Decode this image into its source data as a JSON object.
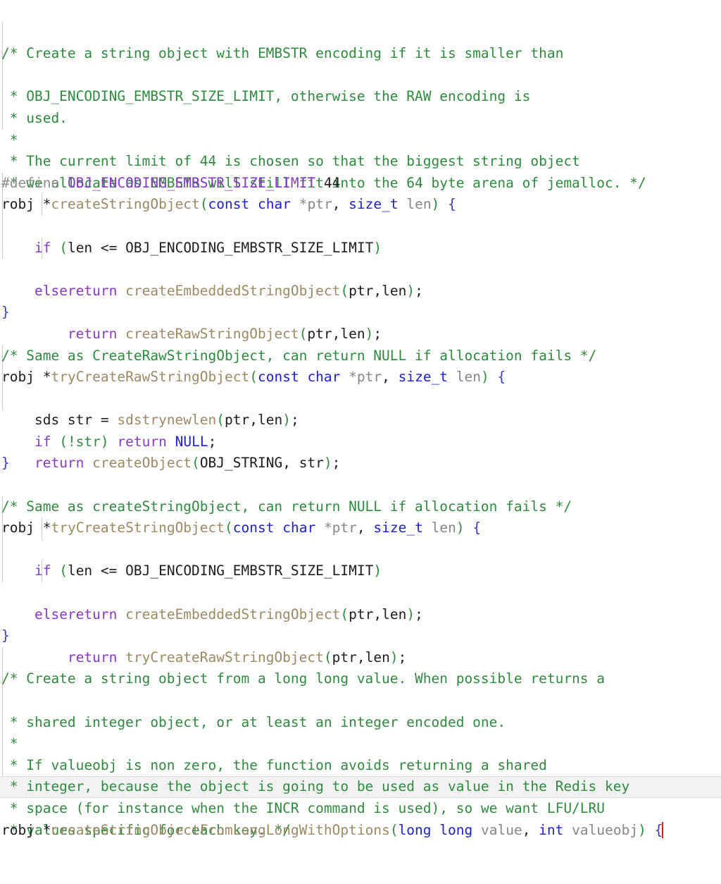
{
  "editor": {
    "language": "c",
    "background": "#ffffff",
    "current_line_highlight": "#f2f2f2",
    "caret_color": "#cc2222",
    "colors": {
      "comment": "#2e8b3d",
      "keyword": "#8a39c4",
      "type": "#2020d0",
      "constant": "#2020d0",
      "function": "#9c8a62",
      "identifier": "#1d1d1d",
      "parameter": "#878787",
      "preprocessor": "#8e8e8e",
      "macro": "#8a39c4",
      "punctuation": "#2e8b3d",
      "brace": "#3b3bbf",
      "indent_guide": "#c8c8c8"
    }
  },
  "code": {
    "l1": "/* Create a string object with EMBSTR encoding if it is smaller than",
    "l2": " * OBJ_ENCODING_EMBSTR_SIZE_LIMIT, otherwise the RAW encoding is",
    "l3": " * used.",
    "l4": " *",
    "l5": " * The current limit of 44 is chosen so that the biggest string object",
    "l6": " * we allocate as EMBSTR will still fit into the 64 byte arena of jemalloc. */",
    "l7_define": "#define",
    "l7_macro": "OBJ_ENCODING_EMBSTR_SIZE_LIMIT",
    "l7_value": "44",
    "l8_type": "robj",
    "l8_star": "*",
    "l8_fn": "createStringObject",
    "l8_open": "(",
    "l8_const": "const",
    "l8_char": "char",
    "l8_ptr": "*ptr",
    "l8_comma": ", ",
    "l8_sizet": "size_t",
    "l8_len": "len",
    "l8_close": ")",
    "l8_brace": "{",
    "l9_if": "if",
    "l9_cond": "(len <= OBJ_ENCODING_EMBSTR_SIZE_LIMIT)",
    "l9_cond_open": "(",
    "l9_cond_id": "len <= OBJ_ENCODING_EMBSTR_SIZE_LIMIT",
    "l9_cond_close": ")",
    "l10_return": "return",
    "l10_fn": "createEmbeddedStringObject",
    "l10_args_open": "(",
    "l10_args": "ptr,len",
    "l10_args_close": ")",
    "l10_semi": ";",
    "l11_else": "else",
    "l12_return": "return",
    "l12_fn": "createRawStringObject",
    "l12_args_open": "(",
    "l12_args": "ptr,len",
    "l12_args_close": ")",
    "l12_semi": ";",
    "l13_brace": "}",
    "l15": "/* Same as CreateRawStringObject, can return NULL if allocation fails */",
    "l16_type": "robj",
    "l16_star": "*",
    "l16_fn": "tryCreateRawStringObject",
    "l17_sds": "sds str = ",
    "l17_fn": "sdstrynewlen",
    "l17_open": "(",
    "l17_args": "ptr,len",
    "l17_close": ")",
    "l17_semi": ";",
    "l18_if": "if",
    "l18_open": "(!str)",
    "l18_return": "return",
    "l18_null": "NULL",
    "l18_semi": ";",
    "l19_return": "return",
    "l19_fn": "createObject",
    "l19_open": "(",
    "l19_args": "OBJ_STRING, str",
    "l19_close": ")",
    "l19_semi": ";",
    "l20_brace": "}",
    "l22": "/* Same as createStringObject, can return NULL if allocation fails */",
    "l23_fn": "tryCreateStringObject",
    "l27_fn": "tryCreateRawStringObject",
    "l31": "/* Create a string object from a long long value. When possible returns a",
    "l32": " * shared integer object, or at least an integer encoded one.",
    "l33": " *",
    "l34": " * If valueobj is non zero, the function avoids returning a shared",
    "l35": " * integer, because the object is going to be used as value in the Redis key",
    "l36": " * space (for instance when the INCR command is used), so we want LFU/LRU",
    "l37": " * values specific for each key. */",
    "l38_type": "robj",
    "l38_star": "*",
    "l38_fn": "createStringObjectFromLongLongWithOptions",
    "l38_open": "(",
    "l38_long": "long long",
    "l38_value": "value",
    "l38_comma": ", ",
    "l38_int": "int",
    "l38_valueobj": "valueobj",
    "l38_close": ")",
    "l38_brace": "{",
    "indent4": "    ",
    "indent8": "        ",
    "blank": ""
  }
}
